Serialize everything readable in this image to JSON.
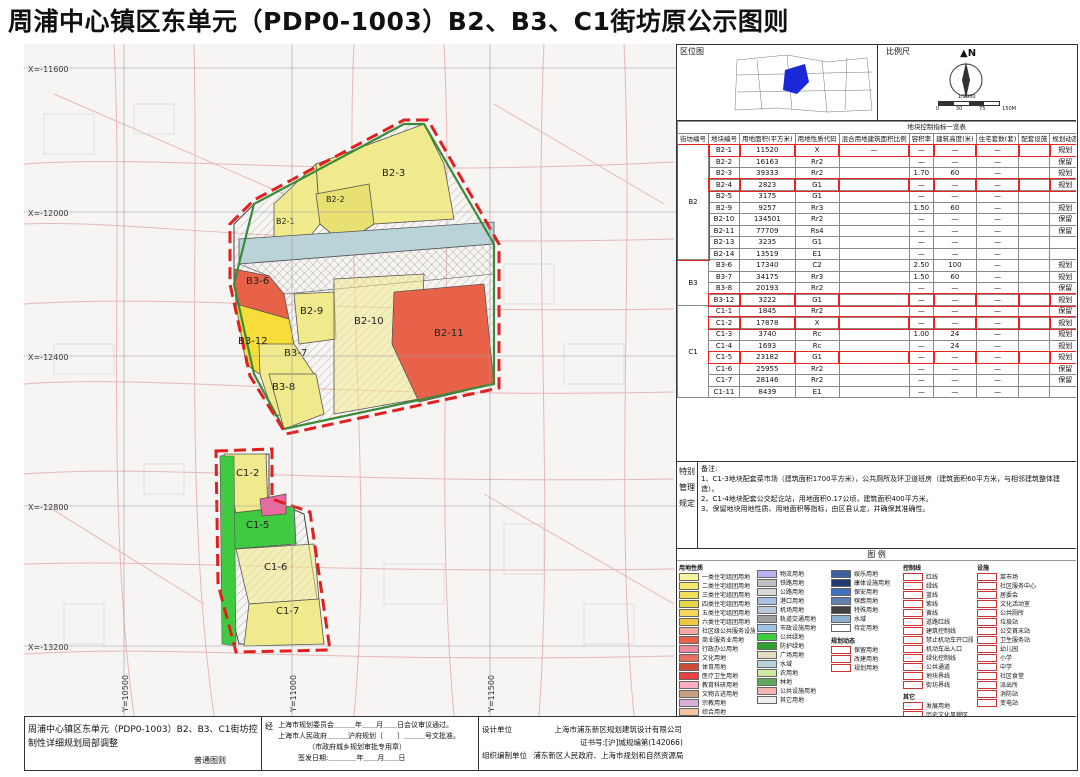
{
  "title": "周浦中心镇区东单元（PDP0-1003）B2、B3、C1街坊原公示图则",
  "map": {
    "coord_labels": [
      "X=-11600",
      "X=-12000",
      "X=-12400",
      "X=-12800",
      "X=-13200"
    ],
    "y_labels": [
      "Y=10500",
      "Y=11000",
      "Y=11500"
    ],
    "blocks": [
      "B2-3",
      "B2-2",
      "B2-1",
      "B2-9",
      "B2-10",
      "B2-11",
      "B3-6",
      "B3-12",
      "B3-7",
      "B3-8",
      "C1-2",
      "C1-5",
      "C1-6",
      "C1-7"
    ],
    "colors": {
      "residential": "#f0ea8c",
      "green": "#3fcb3f",
      "commercial": "#e8624a",
      "school": "#f6dd3a",
      "water": "#b9d3d8",
      "boundary": "#e02020"
    }
  },
  "panels": {
    "location_label": "区位图",
    "scale_label": "比例尺",
    "scale_text": "1/2000",
    "scale_ticks": [
      "0",
      "30",
      "75",
      "150M"
    ]
  },
  "table": {
    "caption": "地块控制指标一览表",
    "headers": [
      "街坊编号",
      "地块编号",
      "用地面积(平方米)",
      "用地性质代码",
      "混合用地建筑面积比例",
      "容积率",
      "建筑高度(米)",
      "住宅套数(套)",
      "配套设施",
      "规划动态",
      "备注"
    ],
    "groups": [
      {
        "label": "B2",
        "rows": [
          {
            "id": "B2-1",
            "area": "11520",
            "code": "X",
            "ratio": "—",
            "far": "—",
            "h": "—",
            "units": "—",
            "fac": "",
            "dyn": "规划",
            "note": "建议设置街坊居委、活动室、服务站用房",
            "hl": true
          },
          {
            "id": "B2-2",
            "area": "16163",
            "code": "Rr2",
            "ratio": "",
            "far": "—",
            "h": "—",
            "units": "—",
            "fac": "",
            "dyn": "保留",
            "note": "汇丽苑",
            "hl": false
          },
          {
            "id": "B2-3",
            "area": "39333",
            "code": "Rr2",
            "ratio": "",
            "far": "1.70",
            "h": "60",
            "units": "—",
            "fac": "",
            "dyn": "规划",
            "note": "",
            "hl": false
          },
          {
            "id": "B2-4",
            "area": "2823",
            "code": "G1",
            "ratio": "",
            "far": "—",
            "h": "—",
            "units": "—",
            "fac": "",
            "dyn": "规划",
            "note": "",
            "hl": true
          },
          {
            "id": "B2-5",
            "area": "3175",
            "code": "G1",
            "ratio": "",
            "far": "—",
            "h": "—",
            "units": "—",
            "fac": "",
            "dyn": "",
            "note": "",
            "hl": false
          },
          {
            "id": "B2-9",
            "area": "9257",
            "code": "Rr3",
            "ratio": "",
            "far": "1.50",
            "h": "60",
            "units": "—",
            "fac": "",
            "dyn": "规划",
            "note": "",
            "hl": false
          },
          {
            "id": "B2-10",
            "area": "134501",
            "code": "Rr2",
            "ratio": "",
            "far": "—",
            "h": "—",
            "units": "—",
            "fac": "",
            "dyn": "保留",
            "note": "汇丽苑",
            "hl": false
          },
          {
            "id": "B2-11",
            "area": "77709",
            "code": "Rs4",
            "ratio": "",
            "far": "—",
            "h": "—",
            "units": "—",
            "fac": "",
            "dyn": "保留",
            "note": "傅雷中学、傅雷小学",
            "hl": false
          },
          {
            "id": "B2-13",
            "area": "3235",
            "code": "G1",
            "ratio": "",
            "far": "—",
            "h": "—",
            "units": "—",
            "fac": "",
            "dyn": "",
            "note": "",
            "hl": false
          },
          {
            "id": "B2-14",
            "area": "13519",
            "code": "E1",
            "ratio": "",
            "far": "—",
            "h": "—",
            "units": "—",
            "fac": "",
            "dyn": "",
            "note": "",
            "hl": false
          }
        ]
      },
      {
        "label": "B3",
        "rows": [
          {
            "id": "B3-6",
            "area": "17340",
            "code": "C2",
            "ratio": "",
            "far": "2.50",
            "h": "100",
            "units": "—",
            "fac": "",
            "dyn": "规划",
            "note": "",
            "hl": false
          },
          {
            "id": "B3-7",
            "area": "34175",
            "code": "Rr3",
            "ratio": "",
            "far": "1.50",
            "h": "60",
            "units": "—",
            "fac": "",
            "dyn": "规划",
            "note": "",
            "hl": false
          },
          {
            "id": "B3-8",
            "area": "20193",
            "code": "Rr2",
            "ratio": "",
            "far": "—",
            "h": "—",
            "units": "—",
            "fac": "",
            "dyn": "保留",
            "note": "润东二村",
            "hl": false
          },
          {
            "id": "B3-12",
            "area": "3222",
            "code": "G1",
            "ratio": "",
            "far": "—",
            "h": "—",
            "units": "—",
            "fac": "",
            "dyn": "规划",
            "note": "",
            "hl": true
          }
        ]
      },
      {
        "label": "C1",
        "rows": [
          {
            "id": "C1-1",
            "area": "1845",
            "code": "Rr2",
            "ratio": "",
            "far": "—",
            "h": "—",
            "units": "—",
            "fac": "",
            "dyn": "保留",
            "note": "桐园公寓",
            "hl": false
          },
          {
            "id": "C1-2",
            "area": "17878",
            "code": "X",
            "ratio": "",
            "far": "—",
            "h": "—",
            "units": "—",
            "fac": "",
            "dyn": "规划",
            "note": "",
            "hl": true
          },
          {
            "id": "C1-3",
            "area": "3740",
            "code": "Rc",
            "ratio": "",
            "far": "1.00",
            "h": "24",
            "units": "—",
            "fac": "",
            "dyn": "规划",
            "note": "菜市场（扩建），设置公厕",
            "hl": false
          },
          {
            "id": "C1-4",
            "area": "1693",
            "code": "Rc",
            "ratio": "",
            "far": "—",
            "h": "24",
            "units": "—",
            "fac": "",
            "dyn": "规划",
            "note": "设置公交起讫站",
            "hl": false
          },
          {
            "id": "C1-5",
            "area": "23182",
            "code": "G1",
            "ratio": "",
            "far": "—",
            "h": "—",
            "units": "—",
            "fac": "",
            "dyn": "规划",
            "note": "",
            "hl": true
          },
          {
            "id": "C1-6",
            "area": "25955",
            "code": "Rr2",
            "ratio": "",
            "far": "—",
            "h": "—",
            "units": "—",
            "fac": "",
            "dyn": "保留",
            "note": "蓬莱公寓",
            "hl": false
          },
          {
            "id": "C1-7",
            "area": "28146",
            "code": "Rr2",
            "ratio": "",
            "far": "—",
            "h": "—",
            "units": "—",
            "fac": "",
            "dyn": "保留",
            "note": "逸亭佳苑",
            "hl": false
          },
          {
            "id": "C1-11",
            "area": "8439",
            "code": "E1",
            "ratio": "",
            "far": "—",
            "h": "—",
            "units": "—",
            "fac": "",
            "dyn": "",
            "note": "",
            "hl": false
          }
        ]
      }
    ]
  },
  "notes": {
    "side_label": "特别管理规定",
    "heading": "备注:",
    "items": [
      "1、C1-3地块配套菜市场（建筑面积1700平方米），公共厕所及环卫道班房（建筑面积60平方米，与相邻建筑整体建造）。",
      "2、C1-4地块配套公交起讫站，用地面积0.17公顷，建筑面积400平方米。",
      "3、保留地块用地性质、用地面积等指标，由区县认定，并确保其准确性。"
    ]
  },
  "legend": {
    "title": "图  例",
    "col1_title": "用地性质",
    "col4_title": "控制线",
    "col5_title": "设施",
    "other_title": "其它",
    "dynamic_title": "规划动态",
    "landuse": [
      {
        "name": "一类住宅组团用地",
        "color": "#fbf2a0"
      },
      {
        "name": "二类住宅组团用地",
        "color": "#f5e76a"
      },
      {
        "name": "三类住宅组团用地",
        "color": "#efe05a"
      },
      {
        "name": "四类住宅组团用地",
        "color": "#e8d64a"
      },
      {
        "name": "五类住宅组团用地",
        "color": "#f6d65a"
      },
      {
        "name": "六类住宅组团用地",
        "color": "#f0c840"
      },
      {
        "name": "社区级公共服务设施",
        "color": "#f2a8a0"
      },
      {
        "name": "商业服务业用地",
        "color": "#e8624a"
      },
      {
        "name": "行政办公用地",
        "color": "#f08aa0"
      },
      {
        "name": "文化用地",
        "color": "#e87060"
      },
      {
        "name": "体育用地",
        "color": "#d04a3a"
      },
      {
        "name": "医疗卫生用地",
        "color": "#f04040"
      },
      {
        "name": "教育科研用地",
        "color": "#f8b0c0"
      },
      {
        "name": "文物古迹用地",
        "color": "#c8a080"
      },
      {
        "name": "宗教用地",
        "color": "#d8b0d8"
      },
      {
        "name": "综合用地",
        "color": "#f6c6a0"
      },
      {
        "name": "一类工业用地",
        "color": "#c8a8d8"
      },
      {
        "name": "二类工业用地",
        "color": "#a888c0"
      },
      {
        "name": "三类工业用地",
        "color": "#886898"
      },
      {
        "name": "普通仓库用地",
        "color": "#b0a0e0"
      },
      {
        "name": "道路用地",
        "color": "#e6e6e6"
      }
    ],
    "landuse2": [
      {
        "name": "物流用地",
        "color": "#c0b0f0"
      },
      {
        "name": "铁路用地",
        "color": "#c0c0c0"
      },
      {
        "name": "公路用地",
        "color": "#d8d8d8"
      },
      {
        "name": "港口用地",
        "color": "#a8c0e0"
      },
      {
        "name": "机场用地",
        "color": "#b8c8d8"
      },
      {
        "name": "轨道交通用地",
        "color": "#a0a0a0"
      },
      {
        "name": "市政设施用地",
        "color": "#9ec4e8"
      },
      {
        "name": "公共绿地",
        "color": "#3fcb3f"
      },
      {
        "name": "防护绿地",
        "color": "#2ea02e"
      },
      {
        "name": "广场用地",
        "color": "#e0e0c0"
      },
      {
        "name": "水域",
        "color": "#b9d3d8"
      },
      {
        "name": "农用地",
        "color": "#d0e8a0"
      },
      {
        "name": "林地",
        "color": "#60a860"
      },
      {
        "name": "公共设施用地",
        "color": "#f4b4b4"
      },
      {
        "name": "其它用地",
        "color": "#f0f0f0"
      }
    ],
    "landuse3": [
      {
        "name": "娱乐用地",
        "color": "#3a60a0"
      },
      {
        "name": "康体设施用地",
        "color": "#203a70"
      },
      {
        "name": "保安用地",
        "color": "#4070c0"
      },
      {
        "name": "殡葬用地",
        "color": "#6080b0"
      },
      {
        "name": "特殊用地",
        "color": "#404040"
      },
      {
        "name": "水域",
        "color": "#88b0d0"
      },
      {
        "name": "待定用地",
        "color": "#ffffff"
      }
    ],
    "controls": [
      "红线",
      "绿线",
      "蓝线",
      "紫线",
      "黄线",
      "道路红线",
      "建筑控制线",
      "禁止机动车开口段",
      "机动车出入口",
      "绿化控制线",
      "公共通道",
      "地块界线",
      "街坊界线"
    ],
    "facilities": [
      "菜市场",
      "社区服务中心",
      "居委会",
      "文化活动室",
      "公共厕所",
      "垃圾站",
      "公交首末站",
      "卫生服务站",
      "幼儿园",
      "小学",
      "中学",
      "社区食堂",
      "派出所",
      "消防站",
      "变电站"
    ],
    "other": [
      "发展用地",
      "历史文化风貌区",
      "保护建筑",
      "规划保留",
      "规划调整",
      "规划新增"
    ],
    "dynamic": [
      "保留用地",
      "改建用地",
      "规划用地"
    ]
  },
  "bottom": {
    "plan_name": "周浦中心镇区东单元（PDP0-1003）B2、B3、C1街坊控制性详细规划局部调整",
    "plan_type": "普通图则",
    "approval_label": "经",
    "approval_1": "上海市规划委员会＿＿＿年＿＿月＿＿日会议审议通过。",
    "approval_2": "上海市人民政府＿＿＿沪府规划〔　　〕＿＿＿号文批准。",
    "approval_3": "（市政府城乡规划审批专用章）",
    "sign_date": "签发日期:＿＿＿＿年＿＿月＿＿日",
    "design_label": "设计单位",
    "design_unit": "上海市浦东新区规划建筑设计有限公司",
    "cert_label": "证书号:",
    "cert_no": "[沪]城规编第(142066)",
    "org_label": "组织编制单位",
    "org_unit": "浦东新区人民政府、上海市规划和自然资源局"
  }
}
